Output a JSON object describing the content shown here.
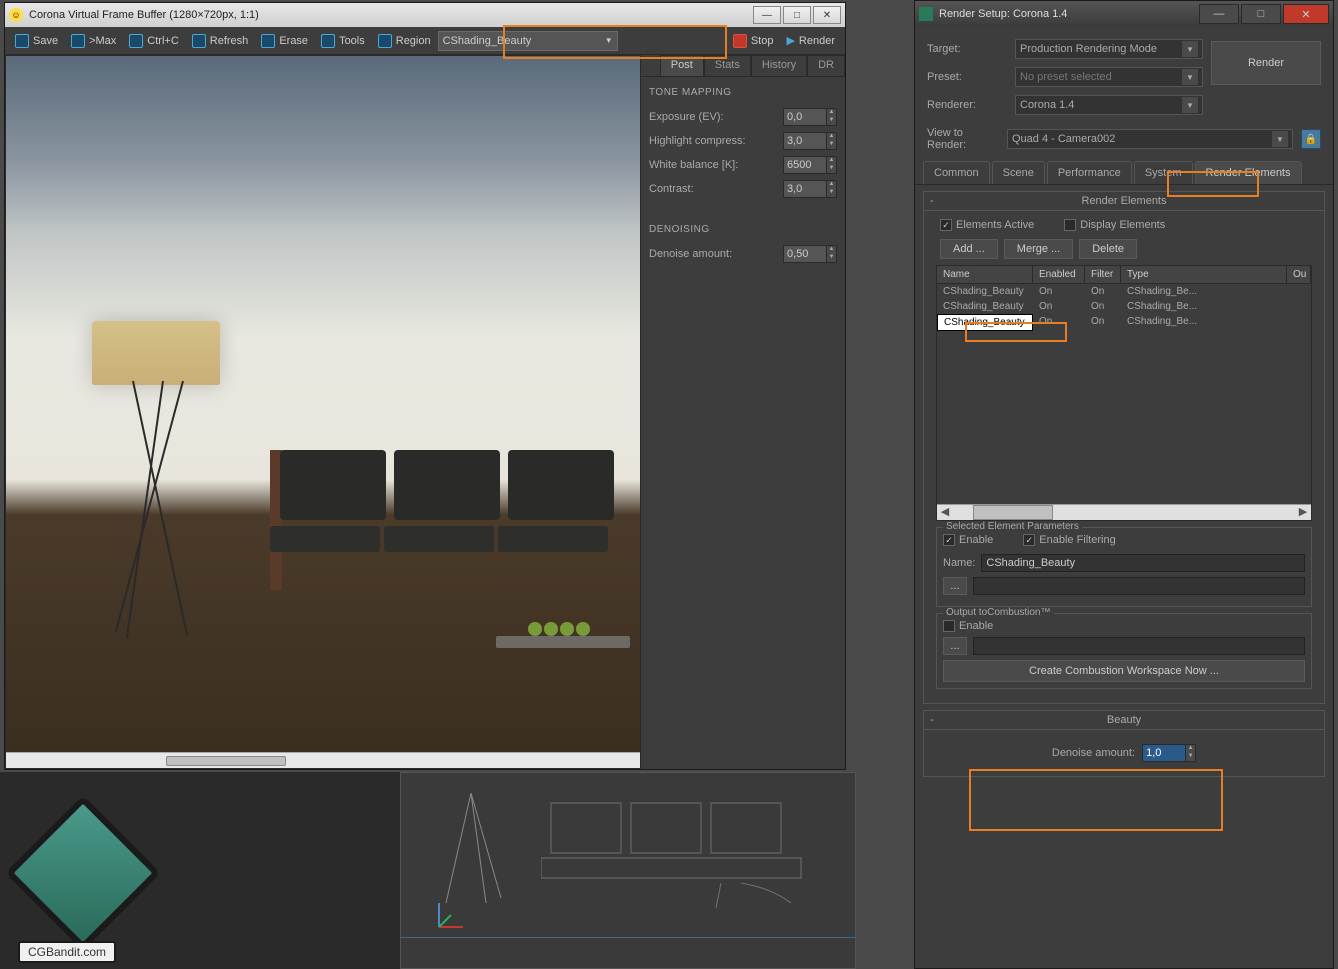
{
  "vfb": {
    "title": "Corona Virtual Frame Buffer (1280×720px, 1:1)",
    "toolbar": {
      "save": "Save",
      "max": ">Max",
      "ctrlc": "Ctrl+C",
      "refresh": "Refresh",
      "erase": "Erase",
      "tools": "Tools",
      "region": "Region",
      "stop": "Stop",
      "render": "Render",
      "pass_selected": "CShading_Beauty"
    },
    "tabs": {
      "post": "Post",
      "stats": "Stats",
      "history": "History",
      "dr": "DR"
    },
    "tonemapping": {
      "title": "TONE MAPPING",
      "exposure_label": "Exposure (EV):",
      "exposure_val": "0,0",
      "highlight_label": "Highlight compress:",
      "highlight_val": "3,0",
      "wb_label": "White balance [K]:",
      "wb_val": "6500",
      "contrast_label": "Contrast:",
      "contrast_val": "3,0"
    },
    "denoising": {
      "title": "DENOISING",
      "amount_label": "Denoise amount:",
      "amount_val": "0,50"
    }
  },
  "rs": {
    "title": "Render Setup: Corona 1.4",
    "target_label": "Target:",
    "target_val": "Production Rendering Mode",
    "preset_label": "Preset:",
    "preset_val": "No preset selected",
    "renderer_label": "Renderer:",
    "renderer_val": "Corona 1.4",
    "view_label": "View to Render:",
    "view_val": "Quad 4 - Camera002",
    "render_btn": "Render",
    "tabs": {
      "common": "Common",
      "scene": "Scene",
      "perf": "Performance",
      "system": "System",
      "re": "Render Elements"
    },
    "re": {
      "title": "Render Elements",
      "elements_active": "Elements Active",
      "display_elements": "Display Elements",
      "add": "Add ...",
      "merge": "Merge ...",
      "delete": "Delete",
      "cols": {
        "name": "Name",
        "enabled": "Enabled",
        "filter": "Filter",
        "type": "Type",
        "out": "Ou"
      },
      "rows": [
        {
          "name": "CShading_Beauty",
          "enabled": "On",
          "filter": "On",
          "type": "CShading_Be..."
        },
        {
          "name": "CShading_Beauty",
          "enabled": "On",
          "filter": "On",
          "type": "CShading_Be..."
        },
        {
          "name": "CShading_Beauty",
          "enabled": "On",
          "filter": "On",
          "type": "CShading_Be..."
        }
      ]
    },
    "sep": {
      "title": "Selected Element Parameters",
      "enable": "Enable",
      "enable_filter": "Enable Filtering",
      "name_label": "Name:",
      "name_val": "CShading_Beauty"
    },
    "combustion": {
      "title": "Output toCombustion™",
      "enable": "Enable",
      "create": "Create Combustion Workspace Now ..."
    },
    "beauty": {
      "title": "Beauty",
      "denoise_label": "Denoise amount:",
      "denoise_val": "1,0"
    }
  },
  "logo_text": "CGBandit.com"
}
